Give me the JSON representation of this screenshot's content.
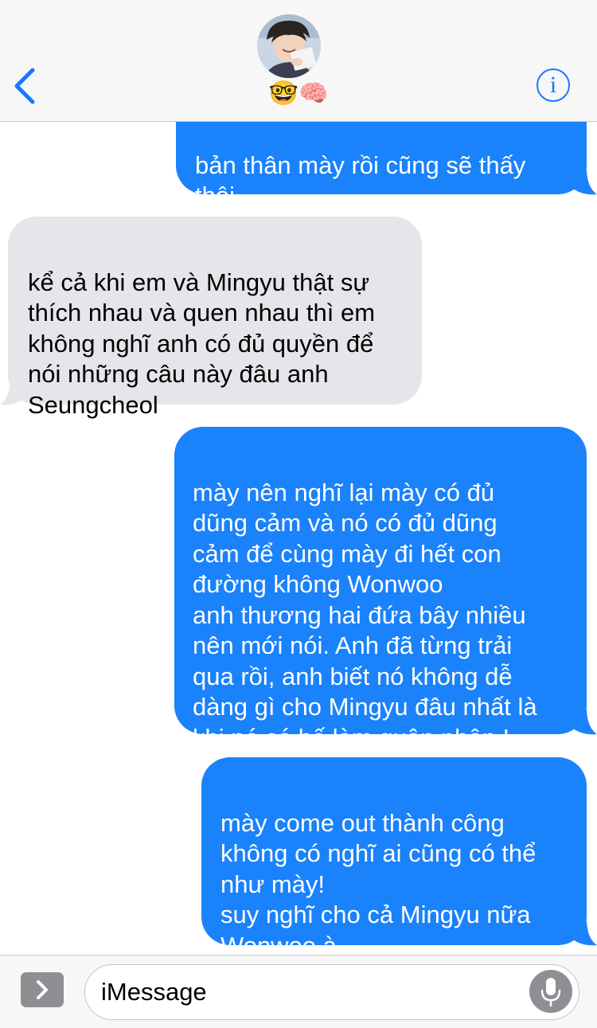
{
  "header": {
    "contact_name": "🤓🧠",
    "back_icon": "chevron-left-icon",
    "info_label": "i"
  },
  "colors": {
    "sent_bubble": "#1a82fb",
    "received_bubble": "#e5e5ea",
    "accent": "#1579ff"
  },
  "messages": [
    {
      "direction": "sent",
      "text": "bản thân mày rồi cũng sẽ thấy\nthôi"
    },
    {
      "direction": "received",
      "text": "kể cả khi em và Mingyu thật sự\nthích nhau và quen nhau thì em\nkhông nghĩ anh có đủ quyền để\nnói những câu này đâu anh\nSeungcheol"
    },
    {
      "direction": "sent",
      "text": "mày nên nghĩ lại mày có đủ\ndũng cảm và nó có đủ dũng\ncảm để cùng mày đi hết con\nđường không Wonwoo\nanh thương hai đứa bây nhiều\nnên mới nói. Anh đã từng trải\nqua rồi, anh biết nó không dễ\ndàng gì cho Mingyu đâu nhất là\nkhi nó có bố làm quân nhân !"
    },
    {
      "direction": "sent",
      "text": "mày come out thành công\nkhông có nghĩ ai cũng có thể\nnhư mày!\nsuy nghĩ cho cả Mingyu nữa\nWonwoo à"
    }
  ],
  "composer": {
    "placeholder": "iMessage",
    "apps_icon": "chevron-right-icon",
    "mic_icon": "microphone-icon"
  }
}
